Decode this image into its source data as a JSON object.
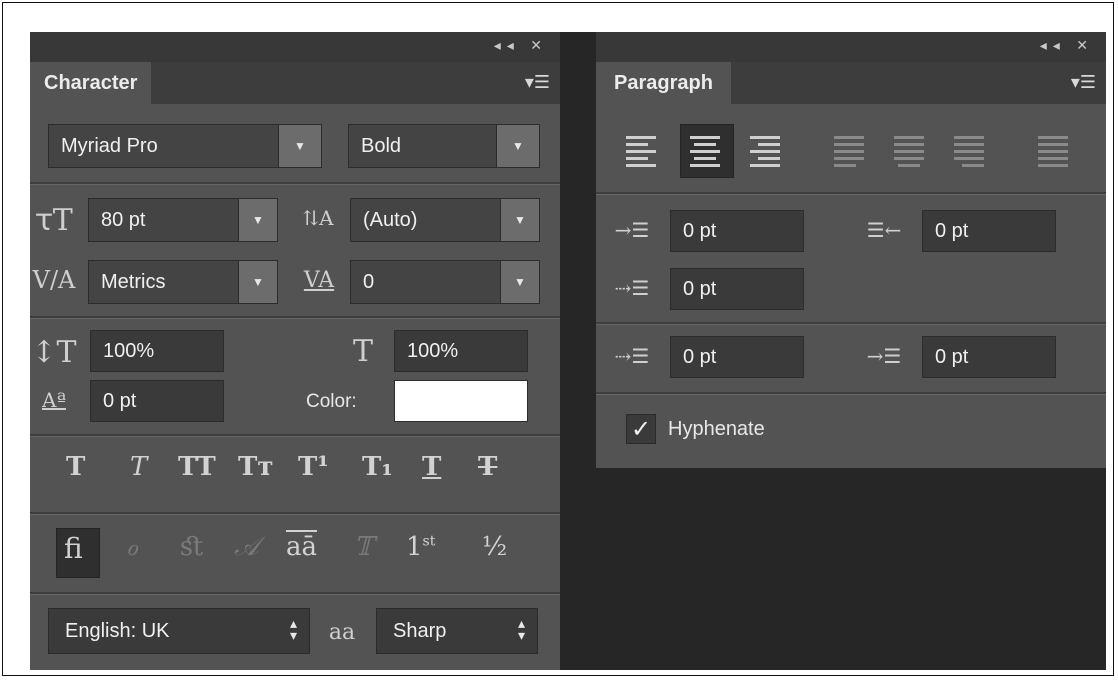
{
  "character": {
    "tab_label": "Character",
    "font_family": "Myriad Pro",
    "font_style": "Bold",
    "font_size": "80 pt",
    "leading": "(Auto)",
    "kerning": "Metrics",
    "tracking": "0",
    "vertical_scale": "100%",
    "horizontal_scale": "100%",
    "baseline_shift": "0 pt",
    "color_label": "Color:",
    "color_value": "#ffffff",
    "style_buttons": [
      "T",
      "T",
      "TT",
      "Tт",
      "T¹",
      "T₁",
      "T",
      "T"
    ],
    "language": "English: UK",
    "aa_glyph": "aa",
    "antialias": "Sharp"
  },
  "paragraph": {
    "tab_label": "Paragraph",
    "indent_left": "0 pt",
    "indent_right": "0 pt",
    "indent_first": "0 pt",
    "space_before": "0 pt",
    "space_after": "0 pt",
    "hyphenate_label": "Hyphenate",
    "hyphenate_checked": true
  },
  "titlebar_icons": [
    "collapse-icon",
    "close-icon"
  ]
}
